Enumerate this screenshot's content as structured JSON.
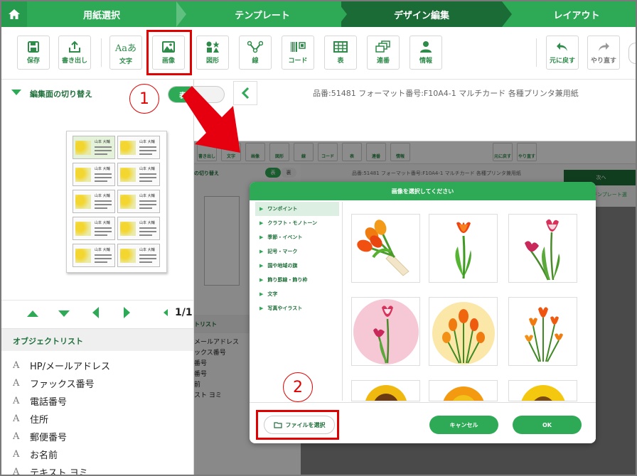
{
  "steps": [
    "用紙選択",
    "テンプレート",
    "デザイン編集",
    "レイアウト"
  ],
  "toolbar": {
    "buttons": [
      "保存",
      "書き出し",
      "文字",
      "画像",
      "図形",
      "線",
      "コード",
      "表",
      "連番",
      "情報"
    ],
    "right_buttons": [
      "元に戻す",
      "やり直す"
    ],
    "text_glyph": "Aaあ"
  },
  "left": {
    "toggle_label": "編集面の切り替え",
    "face_front": "表",
    "page_info": "1/1"
  },
  "product_info": "品番:51481 フォーマット番号:F10A4-1 マルチカード 各種プリンタ兼用紙",
  "preview_card": {
    "name": "山本 大輔"
  },
  "object_list": {
    "title": "オブジェクトリスト",
    "items": [
      "HP/メールアドレス",
      "ファックス番号",
      "電話番号",
      "住所",
      "郵便番号",
      "お名前",
      "テキスト ヨミ"
    ],
    "glyph": "A"
  },
  "callouts": [
    "1",
    "2"
  ],
  "inset": {
    "toolbar_labels": [
      "書き出し",
      "文字",
      "画像",
      "図形",
      "線",
      "コード",
      "表",
      "連番",
      "情報"
    ],
    "right_labels": [
      "元に戻す",
      "やり直す"
    ],
    "toggle_label": "の切り替え",
    "face_front": "表",
    "face_back": "裏",
    "product_info": "品番:51481 フォーマット番号:F10A4-1 マルチカード 各種プリンタ兼用紙",
    "next_button": "次へ",
    "template_tab": "テンプレート選",
    "list_head": "トリスト",
    "list_items": [
      "メールアドレス",
      "ックス番号",
      "番号",
      "",
      "番号",
      "前",
      "スト ヨミ"
    ]
  },
  "dialog": {
    "title": "画像を選択してください",
    "categories": [
      "ワンポイント",
      "クラフト・モノトーン",
      "季節・イベント",
      "記号・マーク",
      "国や地域の旗",
      "飾り罫線・飾り枠",
      "文字",
      "写真やイラスト"
    ],
    "selected_category": "ワンポイント",
    "file_button": "ファイルを選択",
    "cancel_button": "キャンセル",
    "ok_button": "OK"
  },
  "colors": {
    "brand_green": "#2eaa57",
    "dark_green": "#1b6b37",
    "highlight_red": "#e00000"
  }
}
